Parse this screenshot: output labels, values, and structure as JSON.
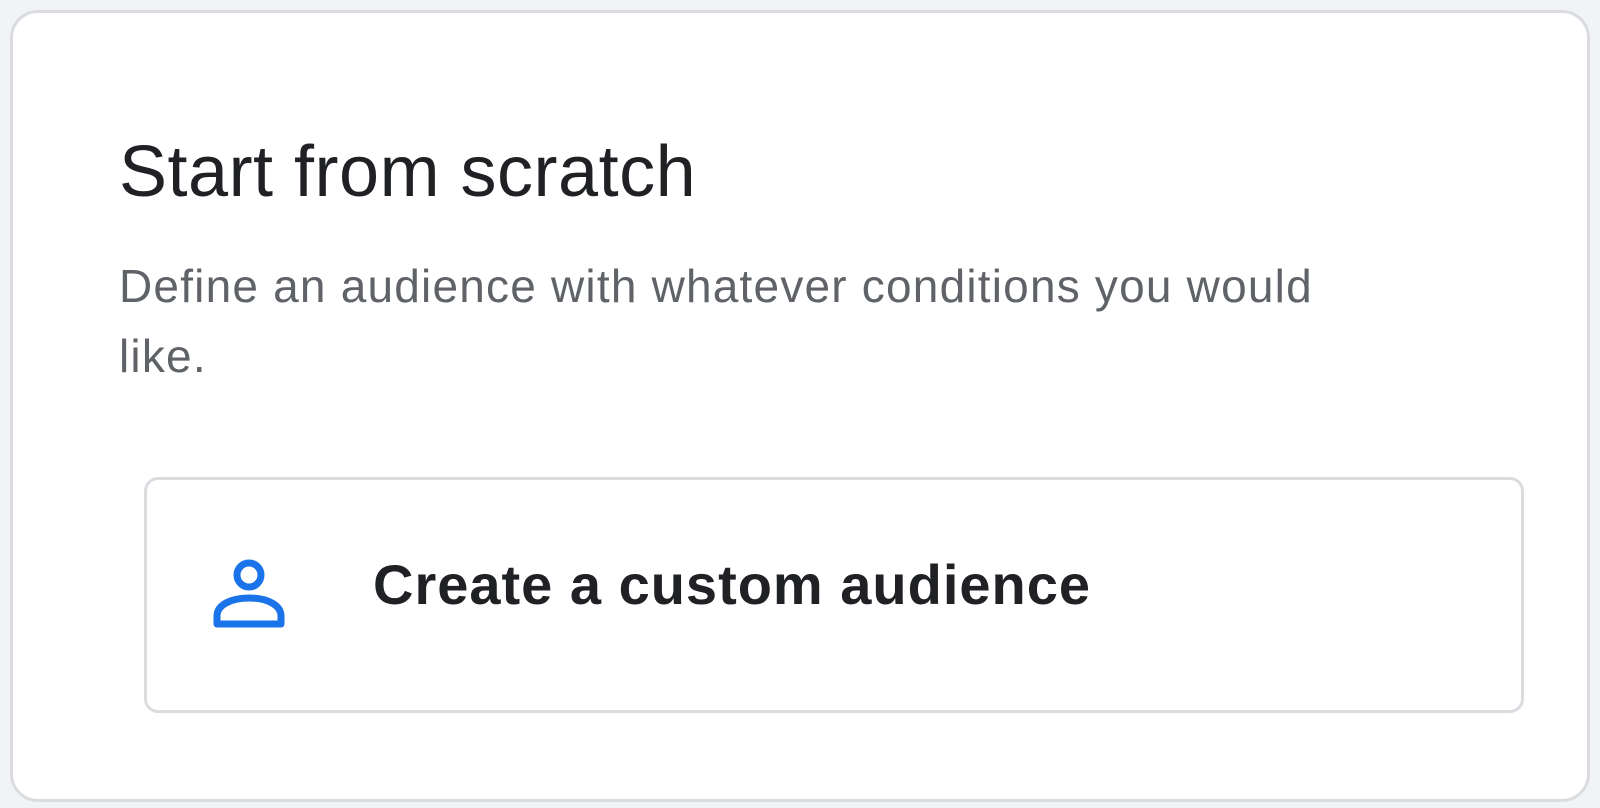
{
  "card": {
    "title": "Start from scratch",
    "description": "Define an audience with whatever conditions you would like."
  },
  "option": {
    "label": "Create a custom audience",
    "icon": "person-icon",
    "icon_color": "#1a73e8"
  }
}
